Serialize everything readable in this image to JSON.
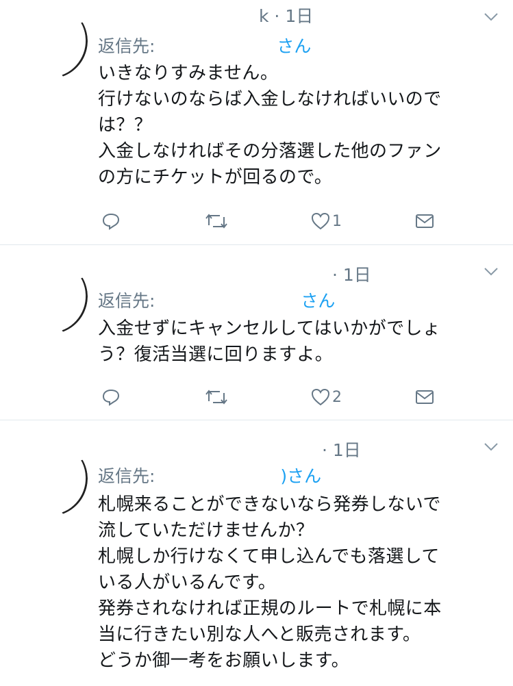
{
  "tweets": [
    {
      "meta": "k · 1日",
      "reply_prefix": "返信先: ",
      "reply_suffix": "さん",
      "body": "いきなりすみません。\n行けないのならば入金しなければいいので\nは？？\n入金しなければその分落選した他のファン\nの方にチケットが回るので。",
      "like_count": "1"
    },
    {
      "meta": "· 1日",
      "reply_prefix": "返信先: ",
      "reply_suffix": "さん",
      "body": "入金せずにキャンセルしてはいかがでしょ\nう？復活当選に回りますよ。",
      "like_count": "2"
    },
    {
      "meta": "· 1日",
      "reply_prefix": "返信先: ",
      "reply_suffix": ")さん",
      "body": "札幌来ることができないなら発券しないで\n流していただけませんか？\n札幌しか行けなくて申し込んでも落選して\nいる人がいるんです。\n発券されなければ正規のルートで札幌に本\n当に行きたい別な人へと販売されます。\nどうか御一考をお願いします。",
      "like_count": ""
    }
  ],
  "icons": {
    "reply": "reply-icon",
    "retweet": "retweet-icon",
    "like": "heart-icon",
    "dm": "envelope-icon",
    "more": "chevron-down-icon"
  },
  "colors": {
    "meta_gray": "#657786",
    "link_blue": "#1da1f2",
    "text": "#14171a",
    "divider": "#e1e8ed"
  }
}
